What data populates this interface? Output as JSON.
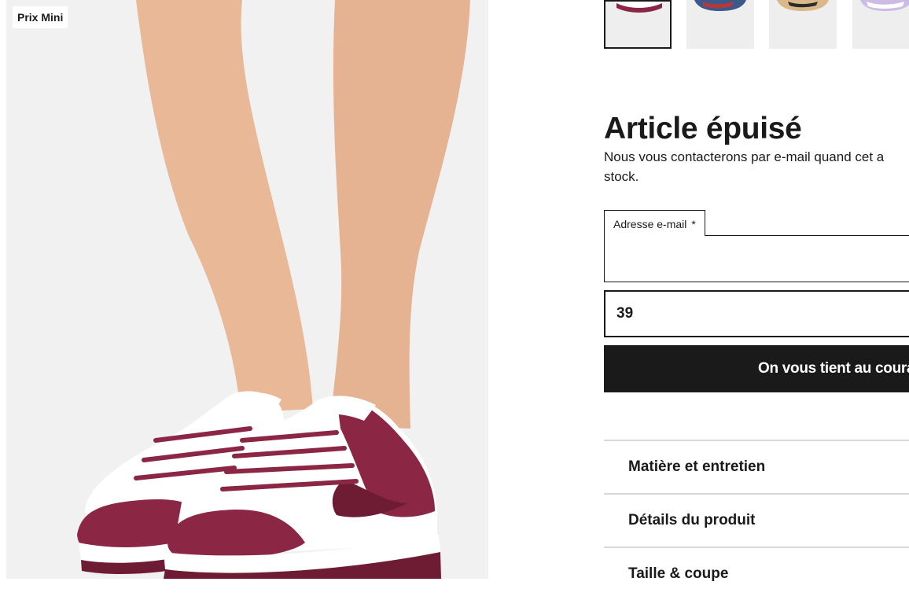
{
  "product": {
    "badge": "Prix Mini",
    "image_alt": "Sneaker basse blanche et bordeaux portée",
    "colors": {
      "burgundy": "#8b2744",
      "burgundy_dark": "#6e1c34",
      "white": "#ffffff",
      "skin": "#e9b897",
      "background": "#f1f1f1"
    }
  },
  "thumbnails": [
    {
      "name": "bordeaux",
      "selected": true
    },
    {
      "name": "multicolore",
      "selected": false
    },
    {
      "name": "beige",
      "selected": false
    },
    {
      "name": "lilas",
      "selected": false
    }
  ],
  "stock": {
    "title": "Article épuisé",
    "message": "Nous vous contacterons par e-mail quand cet a stock."
  },
  "form": {
    "email_label": "Adresse e-mail",
    "required_mark": "*",
    "email_value": "",
    "size_value": "39",
    "notify_label": "On vous tient au courant"
  },
  "accordion": [
    {
      "label": "Matière et entretien"
    },
    {
      "label": "Détails du produit"
    },
    {
      "label": "Taille & coupe"
    }
  ],
  "theme": {
    "text": "#1a1a1a",
    "button_bg": "#1a1a1a",
    "divider": "#d8d8d8"
  }
}
